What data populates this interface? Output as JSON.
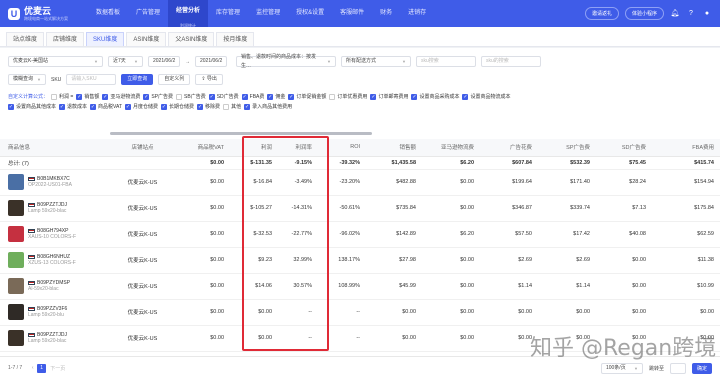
{
  "brand": {
    "name": "优麦云",
    "sub": "跨境电商一站式解决方案"
  },
  "nav": [
    {
      "label": "数据看板",
      "active": false
    },
    {
      "label": "广告管理",
      "active": false
    },
    {
      "label": "经营分析",
      "sub": "利润统计",
      "active": true
    },
    {
      "label": "库存管理",
      "active": false
    },
    {
      "label": "监控管理",
      "active": false
    },
    {
      "label": "授权&设置",
      "active": false
    },
    {
      "label": "客服邮件",
      "active": false
    },
    {
      "label": "财务",
      "active": false
    },
    {
      "label": "进销存",
      "active": false
    }
  ],
  "topright": {
    "invite": "邀请返礼",
    "trial": "体验小程序"
  },
  "tabs": [
    "站点维度",
    "店铺维度",
    "SKU维度",
    "ASIN维度",
    "父ASIN维度",
    "按月维度"
  ],
  "active_tab": 2,
  "filters": {
    "store": "优麦云K-美国站",
    "period": "近7天",
    "date_start": "2021/06/2",
    "date_end": "2021/06/2",
    "metric_select": "销售、退款时间的商品成本：按发生…",
    "dispatch": "所有配送方式",
    "fuzzy": "模糊查询",
    "sku_label": "SKU",
    "sku_placeholder": "请输入SKU",
    "query_btn": "立即查询",
    "custom_btn": "自定义列",
    "export_btn": "导出",
    "sku_ph2": "sku搜索",
    "sku_ph3": "sku的搜索"
  },
  "custom_title": "自定义计算公式：",
  "checks_row1": [
    {
      "label": "利润 =",
      "on": false
    },
    {
      "label": "销售额",
      "on": true
    },
    {
      "label": "亚马逊物流费",
      "on": true
    },
    {
      "label": "SP广告费",
      "on": true
    },
    {
      "label": "SB广告费",
      "on": false
    },
    {
      "label": "SD广告费",
      "on": true
    },
    {
      "label": "FBA费",
      "on": true
    },
    {
      "label": "佣金",
      "on": true
    },
    {
      "label": "订单促销金额",
      "on": true
    },
    {
      "label": "订单优惠费用",
      "on": false
    },
    {
      "label": "订单邮寄费用",
      "on": true
    },
    {
      "label": "设置商品采购成本",
      "on": true
    },
    {
      "label": "设置商品物流成本",
      "on": true
    }
  ],
  "checks_row2": [
    {
      "label": "设置商品其他成本",
      "on": true
    },
    {
      "label": "退款成本",
      "on": true
    },
    {
      "label": "商品税VAT",
      "on": true
    },
    {
      "label": "月度仓储费",
      "on": true
    },
    {
      "label": "长期仓储费",
      "on": true
    },
    {
      "label": "移除费",
      "on": true
    },
    {
      "label": "其他",
      "on": false
    },
    {
      "label": "录入商品其他费用",
      "on": true
    }
  ],
  "columns": [
    "商品信息",
    "店铺站点",
    "商品税VAT",
    "利润",
    "利润率",
    "ROI",
    "销售额",
    "亚马逊物流费",
    "广告花费",
    "SP广告费",
    "SD广告费",
    "FBA费用"
  ],
  "total": {
    "label": "总计: (7)",
    "cells": [
      "",
      "$0.00",
      "$-131.35",
      "-9.15%",
      "-39.32%",
      "$1,435.58",
      "$6.20",
      "$607.84",
      "$532.39",
      "$75.45",
      "$415.74"
    ]
  },
  "rows": [
    {
      "asin": "B0B1MKBX7C",
      "sku": "OP2022-US01-FBA",
      "store": "优麦云K-US",
      "thumb": "#4a6fa5",
      "cells": [
        "$0.00",
        "$-16.84",
        "-3.49%",
        "-23.20%",
        "$482.88",
        "$0.00",
        "$199.64",
        "$171.40",
        "$28.24",
        "$154.94"
      ]
    },
    {
      "asin": "B09PZZTJDJ",
      "sku": "Lamp 59x20-blac",
      "store": "优麦云K-US",
      "thumb": "#3a3128",
      "cells": [
        "$0.00",
        "$-105.27",
        "-14.31%",
        "-50.61%",
        "$735.84",
        "$0.00",
        "$346.87",
        "$339.74",
        "$7.13",
        "$175.84"
      ]
    },
    {
      "asin": "B08GH794XP",
      "sku": "XAUS-10 COLORS-F",
      "store": "优麦云K-US",
      "thumb": "#c53040",
      "cells": [
        "$0.00",
        "$-32.53",
        "-22.77%",
        "-96.02%",
        "$142.89",
        "$6.20",
        "$57.50",
        "$17.42",
        "$40.08",
        "$62.59"
      ]
    },
    {
      "asin": "B08GH6NHUZ",
      "sku": "XZUS-13 COLORS-F",
      "store": "优麦云K-US",
      "thumb": "#6fae5c",
      "cells": [
        "$0.00",
        "$9.23",
        "32.99%",
        "138.17%",
        "$27.98",
        "$0.00",
        "$2.69",
        "$2.69",
        "$0.00",
        "$11.38"
      ]
    },
    {
      "asin": "B09PZYDMSP",
      "sku": "Al-59x20-blac",
      "store": "优麦云K-US",
      "thumb": "#7a6a58",
      "cells": [
        "$0.00",
        "$14.06",
        "30.57%",
        "108.99%",
        "$45.99",
        "$0.00",
        "$1.14",
        "$1.14",
        "$0.00",
        "$10.99"
      ]
    },
    {
      "asin": "B09PZZV3F6",
      "sku": "Lamp 59x20-blu",
      "store": "优麦云K-US",
      "thumb": "#2f2a26",
      "cells": [
        "$0.00",
        "$0.00",
        "--",
        "--",
        "$0.00",
        "$0.00",
        "$0.00",
        "$0.00",
        "$0.00",
        "$0.00"
      ]
    },
    {
      "asin": "B09PZZTJDJ",
      "sku": "Lamp 59x20-blac",
      "store": "优麦云K-US",
      "thumb": "#3a3128",
      "cells": [
        "$0.00",
        "$0.00",
        "--",
        "--",
        "$0.00",
        "$0.00",
        "$0.00",
        "$0.00",
        "$0.00",
        "$0.00"
      ]
    }
  ],
  "footer": {
    "count": "1-7 / 7",
    "prev": "上一页",
    "page": "1",
    "next": "下一页",
    "pagesize": "100条/页",
    "jump": "跳转至",
    "confirm": "确定"
  },
  "watermark": "知乎 @Regan跨境"
}
